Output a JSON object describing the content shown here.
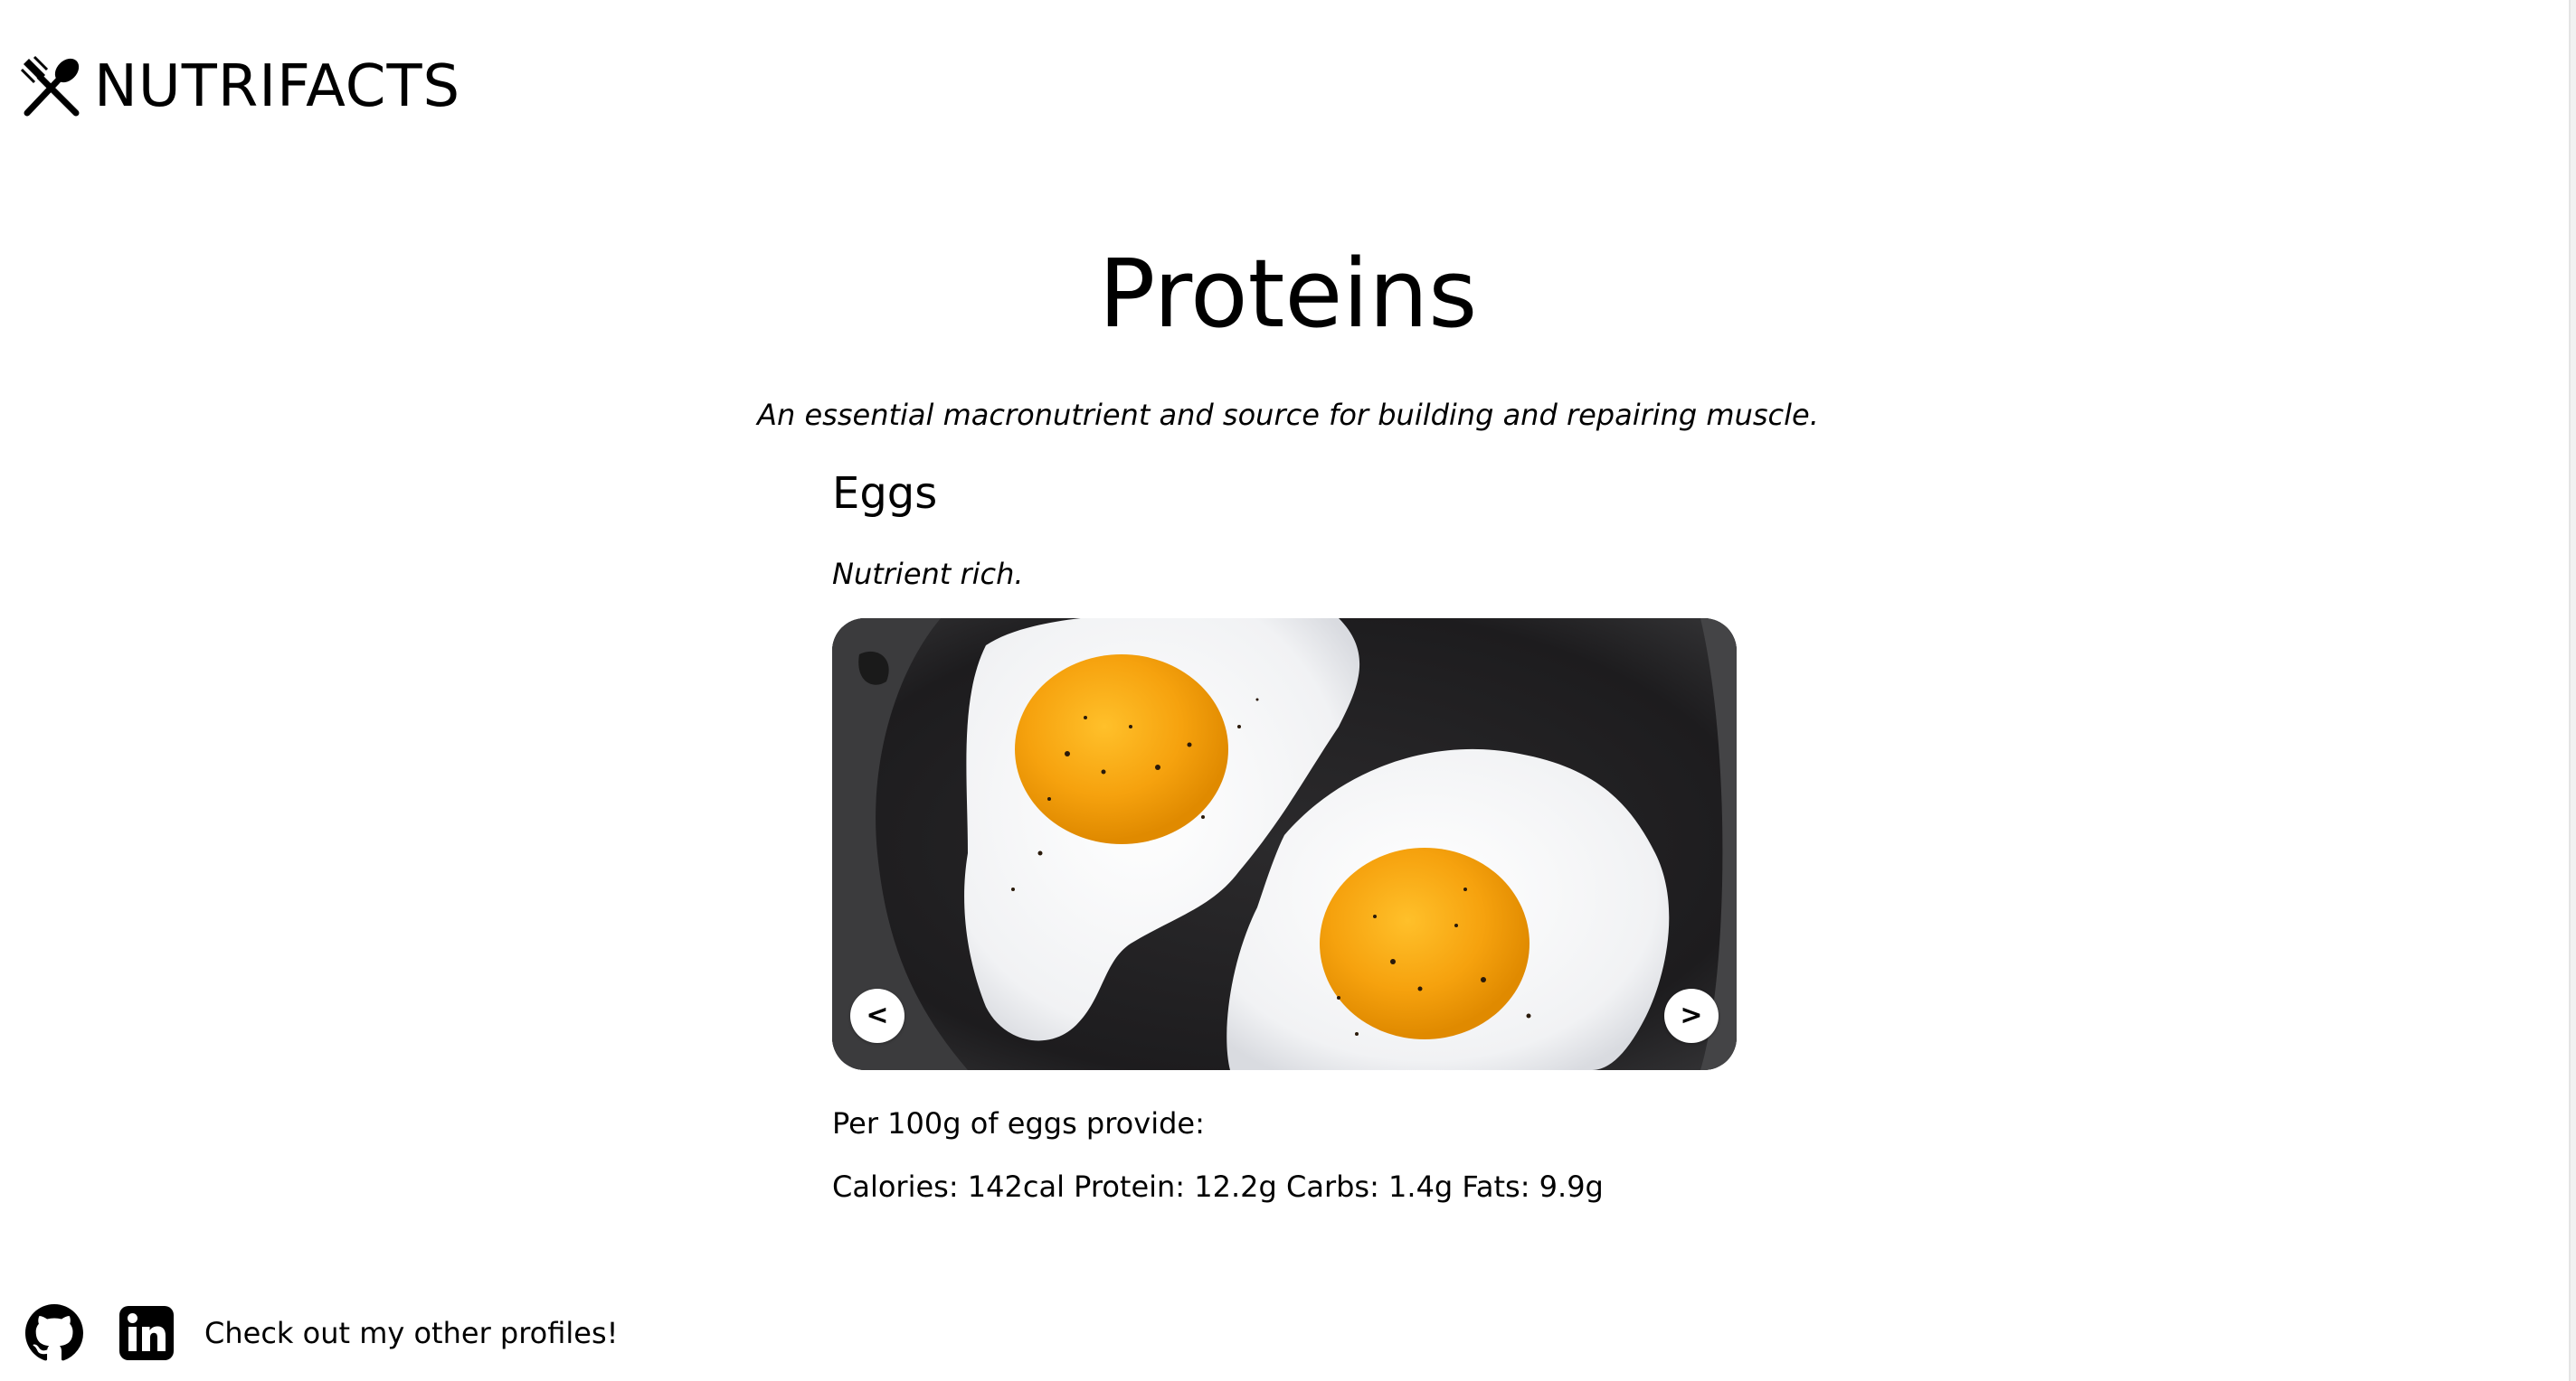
{
  "header": {
    "brand": "NUTRIFACTS",
    "logo_icon": "fork-spoon-icon"
  },
  "main": {
    "title": "Proteins",
    "subtitle": "An essential macronutrient and source for building and repairing muscle."
  },
  "food": {
    "name": "Eggs",
    "tagline": "Nutrient rich.",
    "image_icon": "fried-eggs-photo",
    "prev_label": "<",
    "next_label": ">",
    "per_label": "Per 100g of eggs provide:",
    "macros": {
      "calories": "Calories: 142cal",
      "protein": "Protein: 12.2g",
      "carbs": "Carbs: 1.4g",
      "fats": "Fats: 9.9g"
    }
  },
  "footer": {
    "github_icon": "github-icon",
    "linkedin_icon": "linkedin-icon",
    "text": "Check out my other profiles!"
  }
}
